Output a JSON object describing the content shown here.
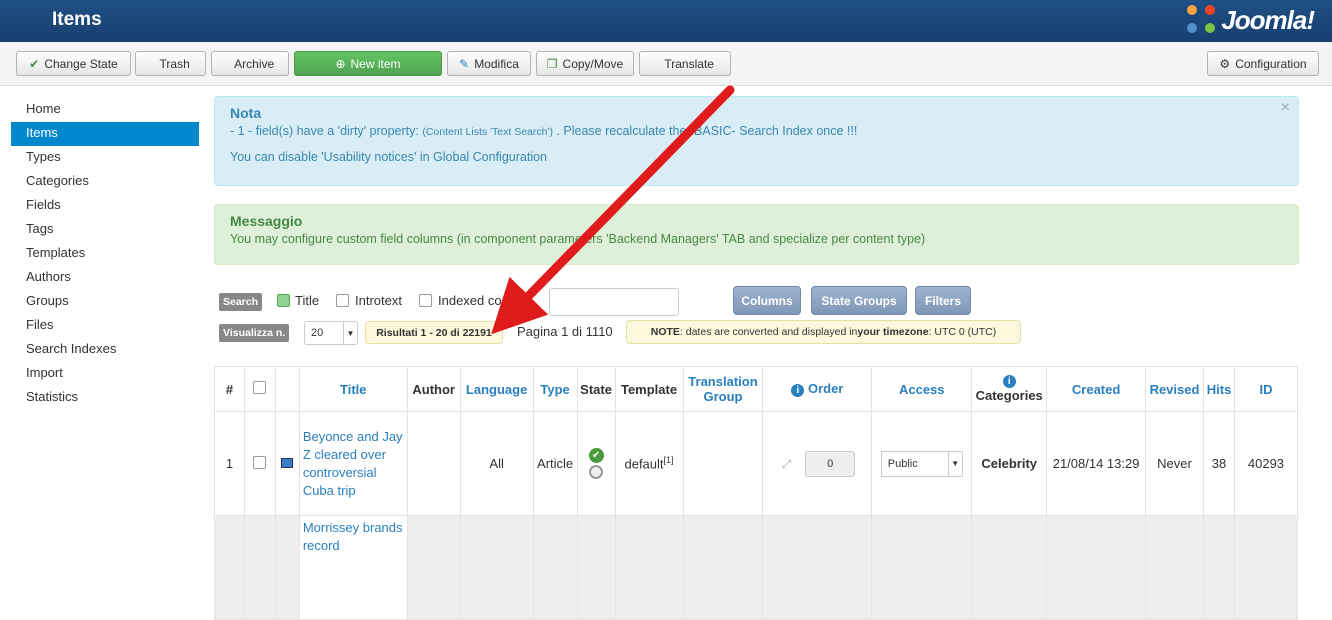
{
  "header": {
    "title": "Items",
    "logo": "Joomla!"
  },
  "toolbar": {
    "change_state": "Change State",
    "trash": "Trash",
    "archive": "Archive",
    "new_item": "New item",
    "modifica": "Modifica",
    "copy_move": "Copy/Move",
    "translate": "Translate",
    "configuration": "Configuration"
  },
  "sidebar": {
    "items": [
      {
        "label": "Home"
      },
      {
        "label": "Items"
      },
      {
        "label": "Types"
      },
      {
        "label": "Categories"
      },
      {
        "label": "Fields"
      },
      {
        "label": "Tags"
      },
      {
        "label": "Templates"
      },
      {
        "label": "Authors"
      },
      {
        "label": "Groups"
      },
      {
        "label": "Files"
      },
      {
        "label": "Search Indexes"
      },
      {
        "label": "Import"
      },
      {
        "label": "Statistics"
      }
    ]
  },
  "notice": {
    "title": "Nota",
    "line1_a": "- 1 - field(s) have a 'dirty' property: ",
    "line1_small": "(Content Lists 'Text Search')",
    "line1_b": " . Please recalculate the -BASIC- Search Index once !!!",
    "line2": "You can disable 'Usability notices' in Global Configuration",
    "close": "×"
  },
  "message": {
    "title": "Messaggio",
    "text": "You may configure custom field columns (in component parameters 'Backend Managers' TAB and specialize per content type)"
  },
  "filters": {
    "search_tag": "Search",
    "title": "Title",
    "introtext": "Introtext",
    "indexed": "Indexed content",
    "columns": "Columns",
    "state_groups": "State Groups",
    "filters": "Filters",
    "display_tag": "Visualizza n.",
    "limit": "20",
    "results": "Risultati 1 - 20 di 22191",
    "page": "Pagina 1 di 1110",
    "note_a": "NOTE",
    "note_b": ": dates are converted and displayed in ",
    "note_c": "your timezone",
    "note_d": ": UTC 0 (UTC)"
  },
  "table": {
    "headers": {
      "num": "#",
      "title": "Title",
      "author": "Author",
      "language": "Language",
      "type": "Type",
      "state": "State",
      "template": "Template",
      "translation_group": "Translation Group",
      "order": "Order",
      "access": "Access",
      "categories": "Categories",
      "created": "Created",
      "revised": "Revised",
      "hits": "Hits",
      "id": "ID"
    },
    "rows": [
      {
        "num": "1",
        "title": "Beyonce and Jay Z cleared over controversial Cuba trip",
        "author": "",
        "language": "All",
        "type": "Article",
        "template": "default",
        "template_sup": "[1]",
        "order": "0",
        "access": "Public",
        "categories": "Celebrity",
        "created": "21/08/14 13:29",
        "revised": "Never",
        "hits": "38",
        "id": "40293"
      },
      {
        "title": "Morrissey brands record"
      }
    ]
  },
  "colors": {
    "header": "#1f4f85",
    "active": "#0088cc",
    "green": "#51a351",
    "arrow": "#e01b1b"
  }
}
